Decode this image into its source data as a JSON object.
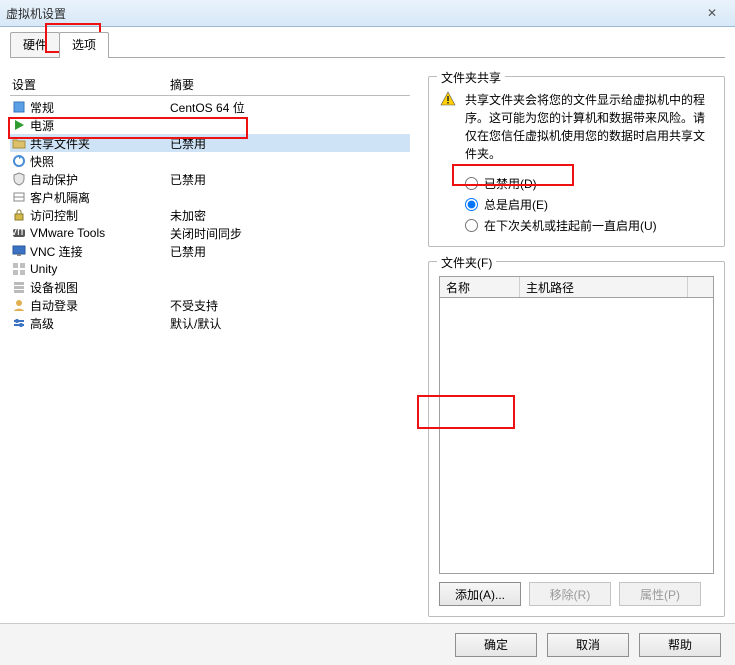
{
  "window": {
    "title": "虚拟机设置",
    "close_glyph": "✕"
  },
  "tabs": {
    "hardware": "硬件",
    "options": "选项",
    "active": "options"
  },
  "left": {
    "headers": {
      "setting": "设置",
      "summary": "摘要"
    },
    "rows": [
      {
        "name": "常规",
        "summary": "CentOS 64 位",
        "icon": "square-icon"
      },
      {
        "name": "电源",
        "summary": "",
        "icon": "power-icon"
      },
      {
        "name": "共享文件夹",
        "summary": "已禁用",
        "icon": "folder-icon",
        "selected": true
      },
      {
        "name": "快照",
        "summary": "",
        "icon": "snapshot-icon"
      },
      {
        "name": "自动保护",
        "summary": "已禁用",
        "icon": "shield-icon"
      },
      {
        "name": "客户机隔离",
        "summary": "",
        "icon": "isolation-icon"
      },
      {
        "name": "访问控制",
        "summary": "未加密",
        "icon": "lock-icon"
      },
      {
        "name": "VMware Tools",
        "summary": "关闭时间同步",
        "icon": "vmtools-icon"
      },
      {
        "name": "VNC 连接",
        "summary": "已禁用",
        "icon": "vnc-icon"
      },
      {
        "name": "Unity",
        "summary": "",
        "icon": "unity-icon"
      },
      {
        "name": "设备视图",
        "summary": "",
        "icon": "device-icon"
      },
      {
        "name": "自动登录",
        "summary": "不受支持",
        "icon": "autologin-icon"
      },
      {
        "name": "高级",
        "summary": "默认/默认",
        "icon": "advanced-icon"
      }
    ]
  },
  "right": {
    "sharing": {
      "legend": "文件夹共享",
      "warning": "共享文件夹会将您的文件显示给虚拟机中的程序。这可能为您的计算机和数据带来风险。请仅在您信任虚拟机使用您的数据时启用共享文件夹。",
      "radios": {
        "disabled": "已禁用(D)",
        "always": "总是启用(E)",
        "until": "在下次关机或挂起前一直启用(U)",
        "selected": "always"
      }
    },
    "folders": {
      "legend": "文件夹(F)",
      "headers": {
        "name": "名称",
        "hostpath": "主机路径"
      },
      "buttons": {
        "add": "添加(A)...",
        "remove": "移除(R)",
        "props": "属性(P)"
      }
    }
  },
  "footer": {
    "ok": "确定",
    "cancel": "取消",
    "help": "帮助"
  }
}
